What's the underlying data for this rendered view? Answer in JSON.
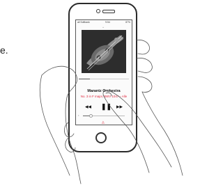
{
  "side_text": "e.",
  "status_bar": {
    "carrier": "all Softbank",
    "time": "9:54",
    "battery": "87%"
  },
  "player": {
    "grabber_icon": "chevron-down-icon",
    "album_art_icon": "violin-photo",
    "progress_fraction": 0.22,
    "title": "Marantz Orchestra",
    "subtitle": "No. 3 in F major, BWV 1047 – Alle",
    "controls": {
      "previous_icon": "rewind-icon",
      "pause_icon": "pause-icon",
      "next_icon": "fast-forward-icon"
    },
    "volume_fraction": 0.18,
    "airplay_icon": "airplay-icon",
    "accent_color": "#e0263c"
  },
  "device": {
    "home_button_icon": "home-button"
  }
}
